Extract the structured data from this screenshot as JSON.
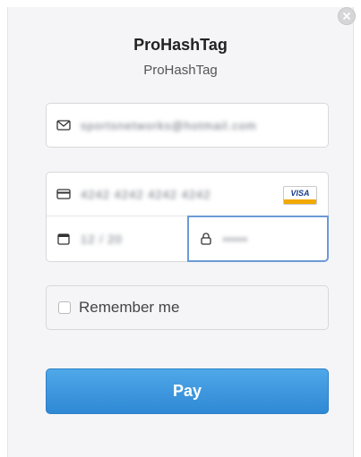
{
  "header": {
    "title": "ProHashTag",
    "subtitle": "ProHashTag"
  },
  "form": {
    "email_value": "sportsnetworks@hotmail.com",
    "card_number_value": "4242 4242 4242 4242",
    "card_brand": "VISA",
    "expiry_value": "12 / 20",
    "cvc_value": "•••••",
    "remember_label": "Remember me",
    "pay_label": "Pay"
  },
  "colors": {
    "pay_button": "#3a96de",
    "focus_border": "#6b9bd6",
    "visa_blue": "#1a3e8c",
    "visa_gold": "#f2a900"
  }
}
